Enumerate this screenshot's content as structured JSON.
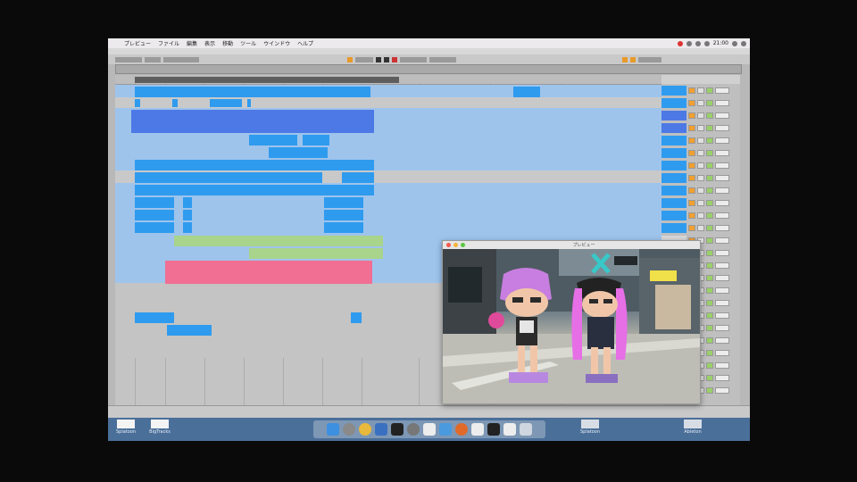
{
  "menubar": {
    "apple": "",
    "items": [
      "プレビュー",
      "ファイル",
      "編集",
      "表示",
      "移動",
      "ツール",
      "ウインドウ",
      "ヘルプ"
    ],
    "clock": "21:00"
  },
  "window": {
    "title": ""
  },
  "video_window": {
    "title": "プレビュー"
  },
  "desktop": {
    "left_items": [
      "Splatoon",
      "BigTracks"
    ],
    "right_items": [
      "Splatoon",
      "Ableton"
    ]
  },
  "colors": {
    "clip_blue": "#2f9bef",
    "clip_light_blue": "#8fbde8",
    "clip_purple_blue": "#4d79e6",
    "clip_green": "#a9d48c",
    "clip_pink": "#f06f93",
    "loop_gray": "#5e5e5e",
    "dock_bg": "#4a6f99"
  },
  "icons": [
    "finder-icon",
    "launchpad-icon",
    "safari-icon",
    "settings-icon",
    "live-icon",
    "chrome-icon",
    "trash-icon"
  ]
}
